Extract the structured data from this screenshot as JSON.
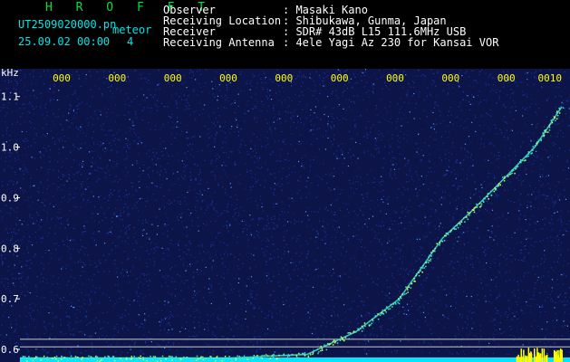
{
  "header": {
    "title": "H R O F F T",
    "filename": "UT2509020000.pn",
    "tag": "meteor",
    "datetime": "25.09.02 00:00",
    "count": "4",
    "info": [
      {
        "label": "Observer",
        "value": ": Masaki Kano"
      },
      {
        "label": "Receiving Location",
        "value": ": Shibukawa, Gunma, Japan"
      },
      {
        "label": "Receiver",
        "value": ": SDR# 43dB L15 111.6MHz USB"
      },
      {
        "label": "Receiving Antenna",
        "value": ": 4ele Yagi Az 230 for Kansai VOR"
      }
    ]
  },
  "chart_data": {
    "type": "heatmap",
    "ylabel": "kHz",
    "y_ticks": [
      "1.1",
      "1.0",
      "0.9",
      "0.8",
      "0.7",
      "0.6"
    ],
    "y_tick_values": [
      1.1,
      1.0,
      0.9,
      0.8,
      0.7,
      0.6
    ],
    "ylim": [
      0.575,
      1.155
    ],
    "time_ticks": [
      "000",
      "000",
      "000",
      "000",
      "000",
      "000",
      "000",
      "000",
      "000",
      "0010"
    ],
    "reference_lines_khz": [
      0.62,
      0.605
    ],
    "trace": [
      {
        "t": 0.0,
        "khz": 0.583
      },
      {
        "t": 3.9,
        "khz": 0.583
      },
      {
        "t": 5.3,
        "khz": 0.59
      },
      {
        "t": 6.2,
        "khz": 0.635
      },
      {
        "t": 7.0,
        "khz": 0.7
      },
      {
        "t": 7.4,
        "khz": 0.76
      },
      {
        "t": 7.8,
        "khz": 0.82
      },
      {
        "t": 8.4,
        "khz": 0.88
      },
      {
        "t": 9.0,
        "khz": 0.945
      },
      {
        "t": 9.5,
        "khz": 1.0
      },
      {
        "t": 10.0,
        "khz": 1.08
      }
    ],
    "colors": {
      "background": "#0c1448",
      "noise_dim": "#1e3cb4",
      "noise_bright": "#50a0ff",
      "trace": "#40e6c8",
      "floor": "#00e6ff",
      "burst": "#ffff00",
      "reference_line": "#c8c8c8"
    },
    "grid": false
  }
}
